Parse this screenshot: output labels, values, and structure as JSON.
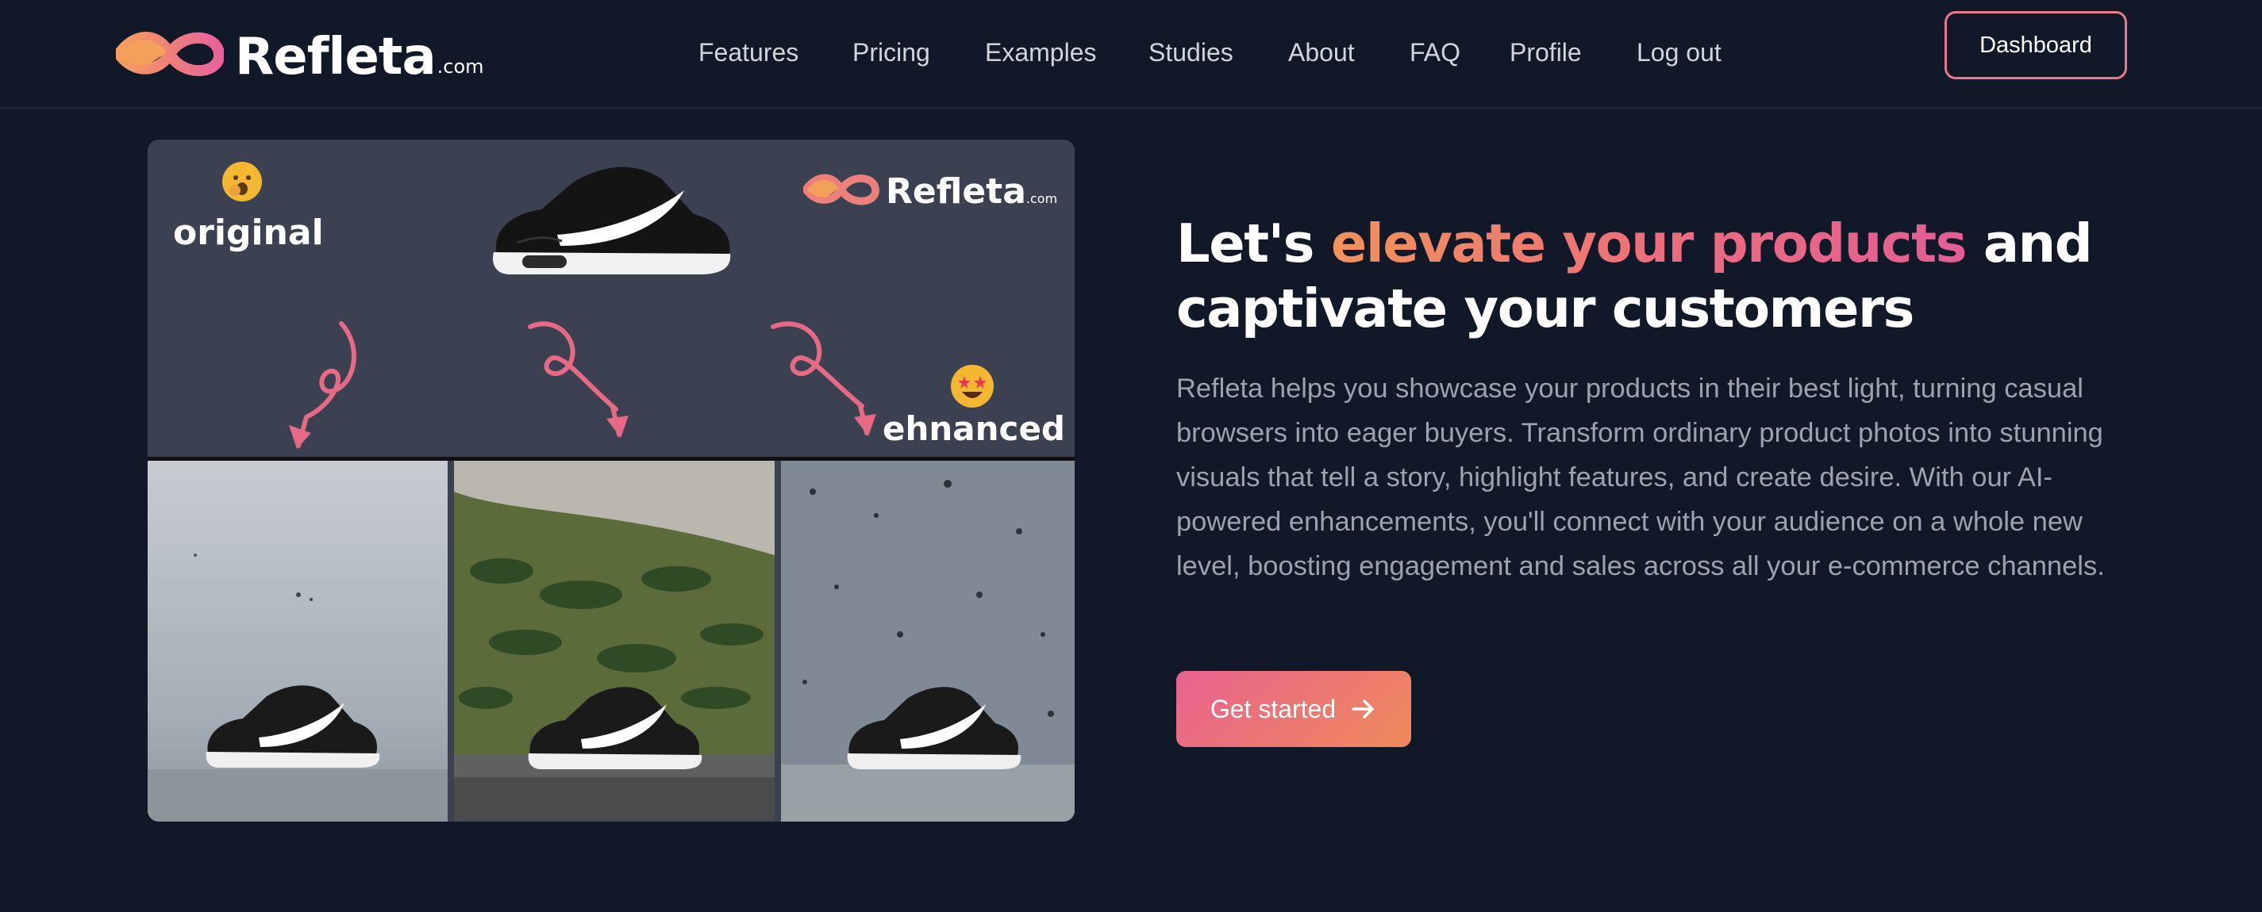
{
  "brand": {
    "name": "Refleta",
    "tld": ".com"
  },
  "nav": {
    "items": [
      {
        "label": "Features"
      },
      {
        "label": "Pricing"
      },
      {
        "label": "Examples"
      },
      {
        "label": "Studies"
      },
      {
        "label": "About"
      },
      {
        "label": "FAQ"
      },
      {
        "label": "Profile"
      },
      {
        "label": "Log out"
      }
    ],
    "dashboard_label": "Dashboard"
  },
  "hero_image": {
    "label_original": "original",
    "label_enhanced": "ehnanced",
    "brand_name": "Refleta",
    "brand_tld": ".com"
  },
  "hero": {
    "headline_pre": "Let's ",
    "headline_highlight": "elevate your products",
    "headline_post": " and captivate your customers",
    "description": "Refleta helps you showcase your products in their best light, turning casual browsers into eager buyers. Transform ordinary product photos into stunning visuals that tell a story, highlight features, and create desire. With our AI-powered enhancements, you'll connect with your audience on a whole new level, boosting engagement and sales across all your e-commerce channels.",
    "cta_label": "Get started",
    "cta_icon": "arrow-right-icon"
  },
  "colors": {
    "background": "#111827",
    "accent_orange": "#f0935a",
    "accent_pink": "#e25e95",
    "muted_text": "#9ca3af"
  }
}
